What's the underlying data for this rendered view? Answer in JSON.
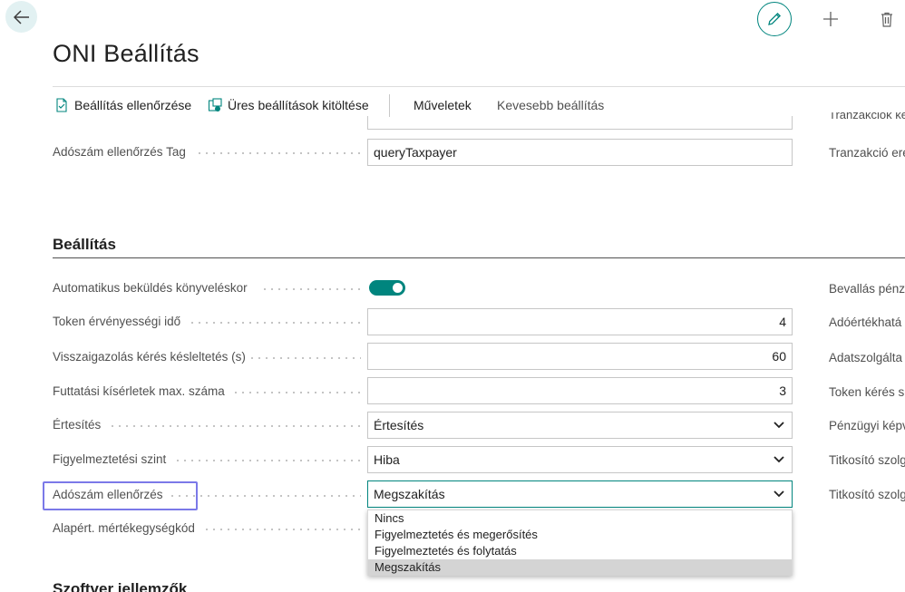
{
  "page": {
    "title": "ONI Beállítás"
  },
  "actions": {
    "check_label": "Beállítás ellenőrzése",
    "fill_label": "Üres beállítások kitöltése",
    "operations_label": "Műveletek",
    "fewer_label": "Kevesebb beállítás"
  },
  "top_section": {
    "clipped_right": "Tranzakciók ke",
    "tax_check_tag": {
      "label": "Adószám ellenőrzés Tag",
      "value": "queryTaxpayer"
    },
    "right_label": "Tranzakció ere"
  },
  "settings": {
    "title": "Beállítás",
    "auto_send": {
      "label": "Automatikus beküldés könyveléskor",
      "value": true
    },
    "token_validity": {
      "label": "Token érvényességi idő",
      "value": "4"
    },
    "ack_delay": {
      "label": "Visszaigazolás kérés késleltetés (s)",
      "value": "60"
    },
    "max_attempts": {
      "label": "Futtatási kísérletek max. száma",
      "value": "3"
    },
    "notification": {
      "label": "Értesítés",
      "value": "Értesítés"
    },
    "warning_level": {
      "label": "Figyelmeztetési szint",
      "value": "Hiba"
    },
    "tax_check": {
      "label": "Adószám ellenőrzés",
      "value": "Megszakítás"
    },
    "default_uom": {
      "label": "Alapért. mértékegységkód"
    },
    "right_labels": [
      "Bevallás pénz",
      "Adóértékhatá",
      "Adatszolgálta",
      "Token kérés s",
      "Pénzügyi képv",
      "Titkosító szolg",
      "Titkosító szolg"
    ]
  },
  "dropdown": {
    "options": [
      "Nincs",
      "Figyelmeztetés és megerősítés",
      "Figyelmeztetés és folytatás",
      "Megszakítás"
    ],
    "selected_index": 3
  },
  "next_section": {
    "title": "Szoftver jellemzők"
  },
  "colors": {
    "accent": "#00857e",
    "highlight": "#7b79e8"
  },
  "icons": [
    "back-arrow-icon",
    "pencil-icon",
    "plus-icon",
    "trash-icon",
    "document-check-icon",
    "fill-settings-icon",
    "chevron-down-icon"
  ]
}
